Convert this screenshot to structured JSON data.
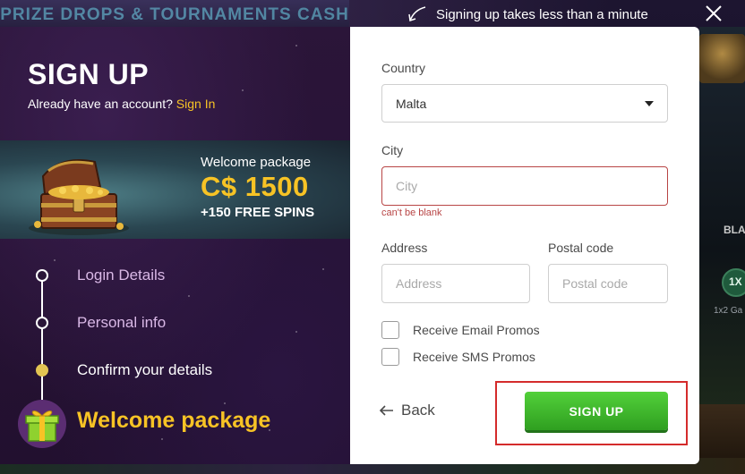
{
  "background": {
    "promo_banner": "PRIZE DROPS & TOURNAMENTS CASH PRIZES ALL DAY LONG",
    "side_text_1": "BLA",
    "side_badge": "1X",
    "side_text_2": "1x2 Ga"
  },
  "hint": {
    "text": "Signing up takes less than a minute"
  },
  "left_panel": {
    "title": "SIGN UP",
    "account_prompt": "Already have an account? ",
    "sign_in_link": "Sign In",
    "welcome": {
      "label": "Welcome package",
      "amount": "C$ 1500",
      "spins": "+150 FREE SPINS"
    },
    "steps": [
      {
        "label": "Login Details",
        "state": "done"
      },
      {
        "label": "Personal info",
        "state": "done"
      },
      {
        "label": "Confirm your details",
        "state": "active"
      }
    ],
    "final_step": "Welcome package"
  },
  "form": {
    "country": {
      "label": "Country",
      "value": "Malta"
    },
    "city": {
      "label": "City",
      "placeholder": "City",
      "value": "",
      "error": "can't be blank"
    },
    "address": {
      "label": "Address",
      "placeholder": "Address",
      "value": ""
    },
    "postal": {
      "label": "Postal code",
      "placeholder": "Postal code",
      "value": ""
    },
    "email_promos": {
      "label": "Receive Email Promos",
      "checked": false
    },
    "sms_promos": {
      "label": "Receive SMS Promos",
      "checked": false
    },
    "back_label": "Back",
    "submit_label": "SIGN UP"
  },
  "colors": {
    "accent_yellow": "#f7c325",
    "button_green": "#3fb82b",
    "error_red": "#b84545",
    "highlight_red": "#d42b2b",
    "panel_purple": "#2b1539"
  }
}
